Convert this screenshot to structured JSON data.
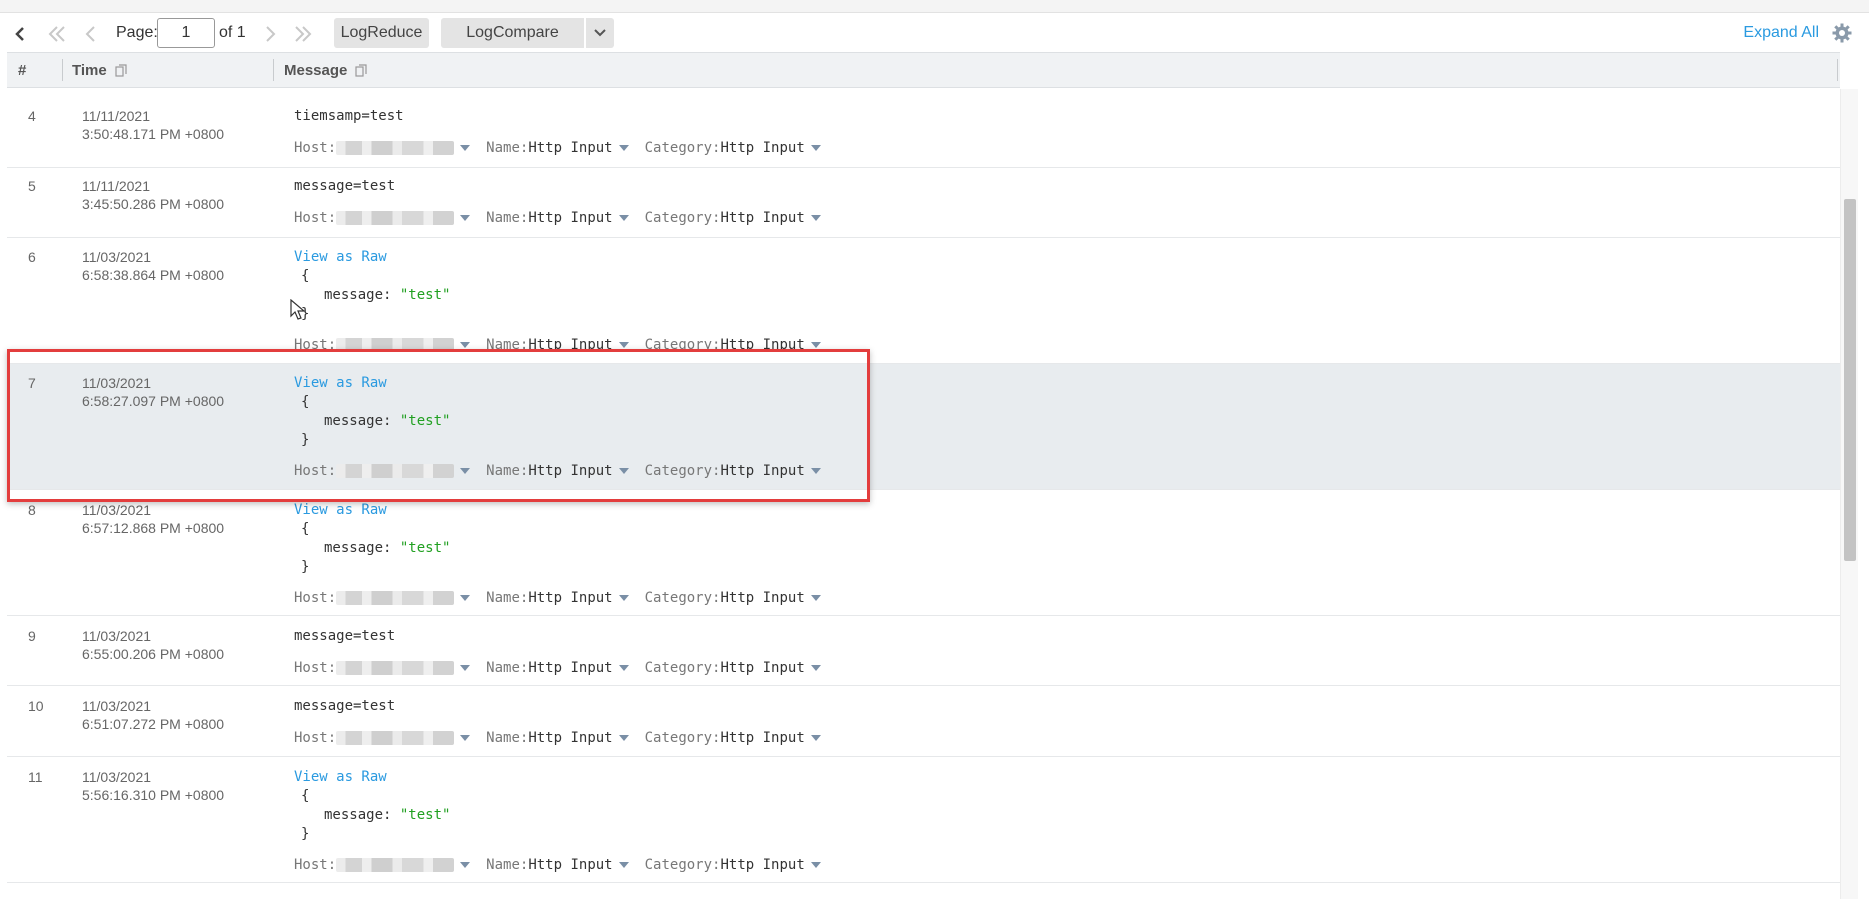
{
  "toolbar": {
    "page_label": "Page:",
    "page_value": "1",
    "page_of": "of 1",
    "logreduce_label": "LogReduce",
    "logcompare_label": "LogCompare",
    "expand_all_label": "Expand All"
  },
  "table": {
    "columns": [
      "#",
      "Time",
      "Message"
    ]
  },
  "rows": [
    {
      "num": "4",
      "date": "11/11/2021",
      "time": "3:50:48.171 PM +0800",
      "message": "tiemsamp=test",
      "fields": {
        "host_key": "Host:",
        "name_key": "Name:",
        "name_val": "Http Input",
        "category_key": "Category:",
        "category_val": "Http Input"
      }
    },
    {
      "num": "5",
      "date": "11/11/2021",
      "time": "3:45:50.286 PM +0800",
      "message": "message=test",
      "fields": {
        "host_key": "Host:",
        "name_key": "Name:",
        "name_val": "Http Input",
        "category_key": "Category:",
        "category_val": "Http Input"
      }
    },
    {
      "num": "6",
      "date": "11/03/2021",
      "time": "6:58:38.864 PM +0800",
      "view_raw": "View as Raw",
      "json": {
        "open": "{",
        "key": "message",
        "sep": ": ",
        "value": "\"test\"",
        "close": "}"
      },
      "fields": {
        "host_key": "Host:",
        "name_key": "Name:",
        "name_val": "Http Input",
        "category_key": "Category:",
        "category_val": "Http Input"
      }
    },
    {
      "num": "7",
      "date": "11/03/2021",
      "time": "6:58:27.097 PM +0800",
      "view_raw": "View as Raw",
      "json": {
        "open": "{",
        "key": "message",
        "sep": ": ",
        "value": "\"test\"",
        "close": "}"
      },
      "fields": {
        "host_key": "Host:",
        "name_key": "Name:",
        "name_val": "Http Input",
        "category_key": "Category:",
        "category_val": "Http Input"
      }
    },
    {
      "num": "8",
      "date": "11/03/2021",
      "time": "6:57:12.868 PM +0800",
      "view_raw": "View as Raw",
      "json": {
        "open": "{",
        "key": "message",
        "sep": ": ",
        "value": "\"test\"",
        "close": "}"
      },
      "fields": {
        "host_key": "Host:",
        "name_key": "Name:",
        "name_val": "Http Input",
        "category_key": "Category:",
        "category_val": "Http Input"
      }
    },
    {
      "num": "9",
      "date": "11/03/2021",
      "time": "6:55:00.206 PM +0800",
      "message": "message=test",
      "fields": {
        "host_key": "Host:",
        "name_key": "Name:",
        "name_val": "Http Input",
        "category_key": "Category:",
        "category_val": "Http Input"
      }
    },
    {
      "num": "10",
      "date": "11/03/2021",
      "time": "6:51:07.272 PM +0800",
      "message": "message=test",
      "fields": {
        "host_key": "Host:",
        "name_key": "Name:",
        "name_val": "Http Input",
        "category_key": "Category:",
        "category_val": "Http Input"
      }
    },
    {
      "num": "11",
      "date": "11/03/2021",
      "time": "5:56:16.310 PM +0800",
      "view_raw": "View as Raw",
      "json": {
        "open": "{",
        "key": "message",
        "sep": ": ",
        "value": "\"test\"",
        "close": "}"
      },
      "fields": {
        "host_key": "Host:",
        "name_key": "Name:",
        "name_val": "Http Input",
        "category_key": "Category:",
        "category_val": "Http Input"
      }
    }
  ],
  "colors": {
    "accent": "#2a9ae0",
    "json_value": "#21a021",
    "selected_row": "#e8ecef",
    "highlight_border": "#e33d3d"
  },
  "icons": [
    "collapse-left-icon",
    "first-page-icon",
    "prev-page-icon",
    "next-page-icon",
    "last-page-icon",
    "chevron-down-icon",
    "gear-icon",
    "copy-icon",
    "caret-down-icon",
    "mouse-cursor-icon"
  ]
}
